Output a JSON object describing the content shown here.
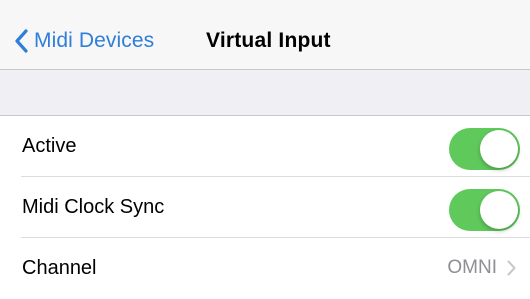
{
  "navbar": {
    "back_label": "Midi Devices",
    "title": "Virtual Input",
    "back_icon": "chevron-left",
    "accent_color": "#2f7ed8"
  },
  "settings": {
    "active": {
      "label": "Active",
      "on": true
    },
    "midi_clock_sync": {
      "label": "Midi Clock Sync",
      "on": true
    },
    "channel": {
      "label": "Channel",
      "value": "OMNI",
      "icon": "chevron-right"
    },
    "toggle_on_color": "#5fc95c"
  }
}
